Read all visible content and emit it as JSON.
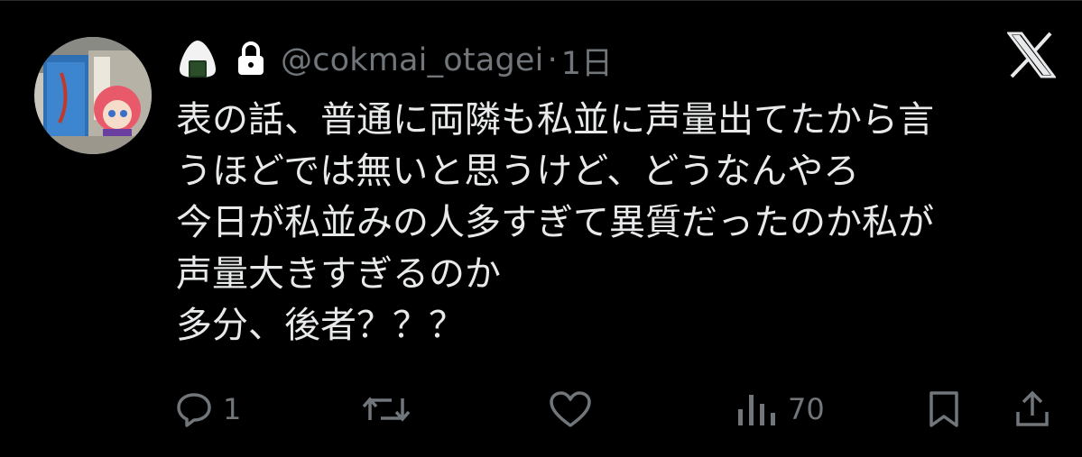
{
  "user": {
    "handle": "@cokmai_otagei",
    "separator": "·",
    "time": "1日"
  },
  "icons": {
    "header_emoji": "onigiri-icon",
    "private": "lock-icon",
    "brand": "x-logo-icon"
  },
  "tweet": {
    "lines": [
      "表の話、普通に両隣も私並に声量出てたから言",
      "うほどでは無いと思うけど、どうなんやろ",
      "今日が私並みの人多すぎて異質だったのか私が",
      "声量大きすぎるのか",
      "多分、後者？？？"
    ]
  },
  "actions": {
    "reply_count": "1",
    "views_count": "70"
  },
  "colors": {
    "background": "#000000",
    "text": "#e7e9ea",
    "muted": "#71767b"
  }
}
